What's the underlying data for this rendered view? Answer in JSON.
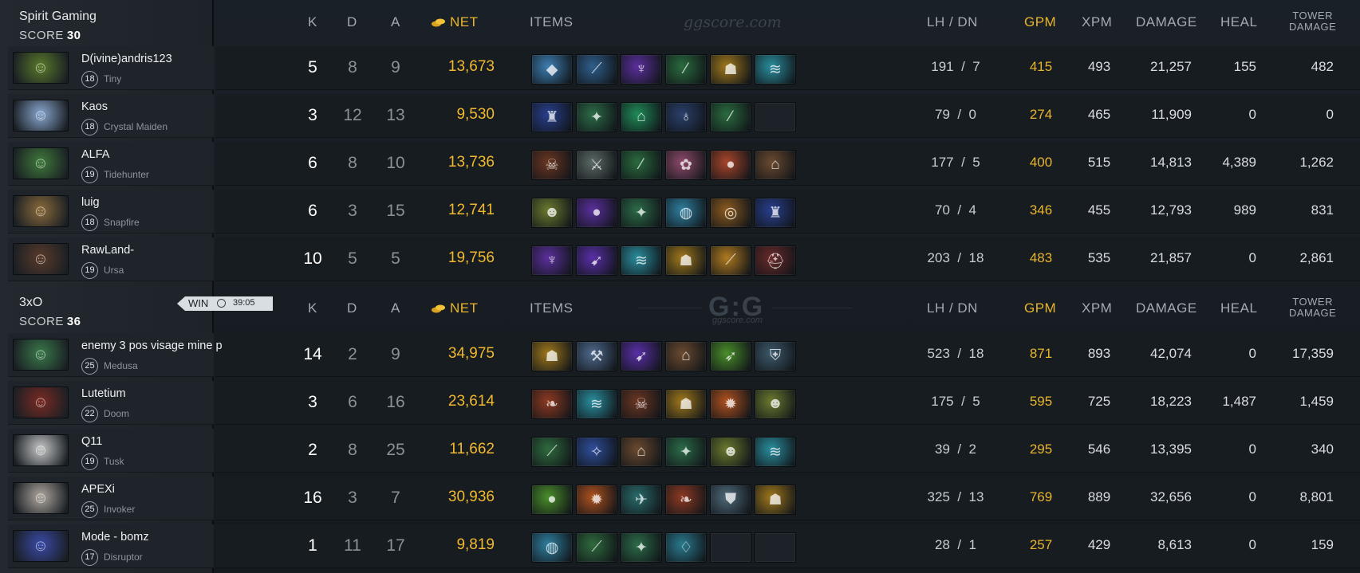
{
  "columns": {
    "k": "K",
    "d": "D",
    "a": "A",
    "net": "NET",
    "items": "ITEMS",
    "lhdn": "LH  /  DN",
    "gpm": "GPM",
    "xpm": "XPM",
    "damage": "DAMAGE",
    "heal": "HEAL",
    "tower1": "TOWER",
    "tower2": "DAMAGE"
  },
  "watermark": {
    "site": "ggscore.com",
    "logo": "G:G",
    "logo_sub": "ggscore.com"
  },
  "result": {
    "label": "WIN",
    "duration": "39:05"
  },
  "teams": [
    {
      "name": "Spirit Gaming",
      "score_label": "SCORE",
      "score": "30",
      "players": [
        {
          "name": "D(ivine)andris123",
          "level": "18",
          "hero": "Tiny",
          "k": "5",
          "d": "8",
          "a": "9",
          "net": "13,673",
          "lh": "191",
          "dn": "7",
          "gpm": "415",
          "xpm": "493",
          "damage": "21,257",
          "heal": "155",
          "tower": "482",
          "items": [
            {
              "icon": "stone-gem-icon",
              "color": "#3d7fb3"
            },
            {
              "icon": "staff-icon",
              "color": "#2f5f8c"
            },
            {
              "icon": "cloak-icon",
              "color": "#5b2f9c"
            },
            {
              "icon": "wand-icon",
              "color": "#2a6b3e"
            },
            {
              "icon": "mask-icon",
              "color": "#a0781c"
            },
            {
              "icon": "blade-icon",
              "color": "#2a8e9e"
            }
          ]
        },
        {
          "name": "Kaos",
          "level": "18",
          "hero": "Crystal Maiden",
          "k": "3",
          "d": "12",
          "a": "13",
          "net": "9,530",
          "lh": "79",
          "dn": "0",
          "gpm": "274",
          "xpm": "465",
          "damage": "11,909",
          "heal": "0",
          "tower": "0",
          "items": [
            {
              "icon": "cape-icon",
              "color": "#283f8e"
            },
            {
              "icon": "scepter-icon",
              "color": "#2c6b48"
            },
            {
              "icon": "boots-icon",
              "color": "#1f8b58"
            },
            {
              "icon": "potion-icon",
              "color": "#2a3f6b"
            },
            {
              "icon": "wand-icon",
              "color": "#2a6b3e"
            },
            {
              "icon": "empty-slot-icon",
              "color": ""
            }
          ]
        },
        {
          "name": "ALFA",
          "level": "19",
          "hero": "Tidehunter",
          "k": "6",
          "d": "8",
          "a": "10",
          "net": "13,736",
          "lh": "177",
          "dn": "5",
          "gpm": "400",
          "xpm": "515",
          "damage": "14,813",
          "heal": "4,389",
          "tower": "1,262",
          "items": [
            {
              "icon": "helm-icon",
              "color": "#6b3622"
            },
            {
              "icon": "sword-icon",
              "color": "#5d6a66"
            },
            {
              "icon": "wand-icon",
              "color": "#2a6b3e"
            },
            {
              "icon": "lotus-icon",
              "color": "#8e4a6b"
            },
            {
              "icon": "orb-icon",
              "color": "#a8452a"
            },
            {
              "icon": "boots-icon",
              "color": "#6b4a2f"
            }
          ]
        },
        {
          "name": "luig",
          "level": "18",
          "hero": "Snapfire",
          "k": "6",
          "d": "3",
          "a": "15",
          "net": "12,741",
          "lh": "70",
          "dn": "4",
          "gpm": "346",
          "xpm": "455",
          "damage": "12,793",
          "heal": "989",
          "tower": "831",
          "items": [
            {
              "icon": "skull-icon",
              "color": "#6b7a2f"
            },
            {
              "icon": "orb-icon",
              "color": "#5a2f9c"
            },
            {
              "icon": "scepter-icon",
              "color": "#2c6b48"
            },
            {
              "icon": "drum-icon",
              "color": "#2f7fa0"
            },
            {
              "icon": "ring-icon",
              "color": "#8c5a1f"
            },
            {
              "icon": "cape-icon",
              "color": "#283f8e"
            }
          ]
        },
        {
          "name": "RawLand-",
          "level": "19",
          "hero": "Ursa",
          "k": "10",
          "d": "5",
          "a": "5",
          "net": "19,756",
          "lh": "203",
          "dn": "18",
          "gpm": "483",
          "xpm": "535",
          "damage": "21,857",
          "heal": "0",
          "tower": "2,861",
          "items": [
            {
              "icon": "cloak-icon",
              "color": "#5b2f9c"
            },
            {
              "icon": "dagger-icon",
              "color": "#5a2fa8"
            },
            {
              "icon": "blade-icon",
              "color": "#2a8e9e"
            },
            {
              "icon": "mask-icon",
              "color": "#a0781c"
            },
            {
              "icon": "rod-icon",
              "color": "#b07a1f"
            },
            {
              "icon": "helmet-icon",
              "color": "#6b2a2a"
            }
          ]
        }
      ]
    },
    {
      "name": "3xO",
      "score_label": "SCORE",
      "score": "36",
      "players": [
        {
          "name": "enemy 3 pos visage mine p",
          "level": "25",
          "hero": "Medusa",
          "k": "14",
          "d": "2",
          "a": "9",
          "net": "34,975",
          "lh": "523",
          "dn": "18",
          "gpm": "871",
          "xpm": "893",
          "damage": "42,074",
          "heal": "0",
          "tower": "17,359",
          "items": [
            {
              "icon": "mask-icon",
              "color": "#a0781c"
            },
            {
              "icon": "axe-icon",
              "color": "#4f6a8e"
            },
            {
              "icon": "dagger-icon",
              "color": "#5a2fa8"
            },
            {
              "icon": "boots-icon",
              "color": "#6b4a2f"
            },
            {
              "icon": "bow-icon",
              "color": "#4a8e2a"
            },
            {
              "icon": "shield-icon",
              "color": "#3d5a6b"
            }
          ]
        },
        {
          "name": "Lutetium",
          "level": "22",
          "hero": "Doom",
          "k": "3",
          "d": "6",
          "a": "16",
          "net": "23,614",
          "lh": "175",
          "dn": "5",
          "gpm": "595",
          "xpm": "725",
          "damage": "18,223",
          "heal": "1,487",
          "tower": "1,459",
          "items": [
            {
              "icon": "horn-icon",
              "color": "#8e3a22"
            },
            {
              "icon": "blade-icon",
              "color": "#2a8e9e"
            },
            {
              "icon": "helm-icon",
              "color": "#6b3622"
            },
            {
              "icon": "mask-icon",
              "color": "#a0781c"
            },
            {
              "icon": "flame-icon",
              "color": "#b0521f"
            },
            {
              "icon": "skull-icon",
              "color": "#6b7a2f"
            }
          ]
        },
        {
          "name": "Q11",
          "level": "19",
          "hero": "Tusk",
          "k": "2",
          "d": "8",
          "a": "25",
          "net": "11,662",
          "lh": "39",
          "dn": "2",
          "gpm": "295",
          "xpm": "546",
          "damage": "13,395",
          "heal": "0",
          "tower": "340",
          "items": [
            {
              "icon": "stick-icon",
              "color": "#2f6b3e"
            },
            {
              "icon": "glaive-icon",
              "color": "#2f4f9c"
            },
            {
              "icon": "boots-icon",
              "color": "#6b4a2f"
            },
            {
              "icon": "scepter-icon",
              "color": "#2c6b48"
            },
            {
              "icon": "skull-icon",
              "color": "#6b7a2f"
            },
            {
              "icon": "blade-icon",
              "color": "#2a8e9e"
            }
          ]
        },
        {
          "name": "APEXi",
          "level": "25",
          "hero": "Invoker",
          "k": "16",
          "d": "3",
          "a": "7",
          "net": "30,936",
          "lh": "325",
          "dn": "13",
          "gpm": "769",
          "xpm": "889",
          "damage": "32,656",
          "heal": "0",
          "tower": "8,801",
          "items": [
            {
              "icon": "orb-icon",
              "color": "#4a8e2a"
            },
            {
              "icon": "flame-icon",
              "color": "#b0521f"
            },
            {
              "icon": "wing-icon",
              "color": "#2a6b6b"
            },
            {
              "icon": "horn-icon",
              "color": "#8e3a22"
            },
            {
              "icon": "armor-icon",
              "color": "#4f6a7a"
            },
            {
              "icon": "mask-icon",
              "color": "#a0781c"
            }
          ]
        },
        {
          "name": "Mode - bomz",
          "level": "17",
          "hero": "Disruptor",
          "k": "1",
          "d": "11",
          "a": "17",
          "net": "9,819",
          "lh": "28",
          "dn": "1",
          "gpm": "257",
          "xpm": "429",
          "damage": "8,613",
          "heal": "0",
          "tower": "159",
          "items": [
            {
              "icon": "drum-icon",
              "color": "#2f7fa0"
            },
            {
              "icon": "stick-icon",
              "color": "#2f6b3e"
            },
            {
              "icon": "scepter-icon",
              "color": "#2c6b48"
            },
            {
              "icon": "bottle-icon",
              "color": "#2a7a8e"
            },
            {
              "icon": "empty-slot-icon",
              "color": ""
            },
            {
              "icon": "empty-slot-icon",
              "color": ""
            }
          ]
        }
      ]
    }
  ],
  "colors": {
    "gold": "#f1b92d",
    "gpm": "#e9b52a",
    "kills": "#ffffff",
    "muted": "#8a9198"
  }
}
